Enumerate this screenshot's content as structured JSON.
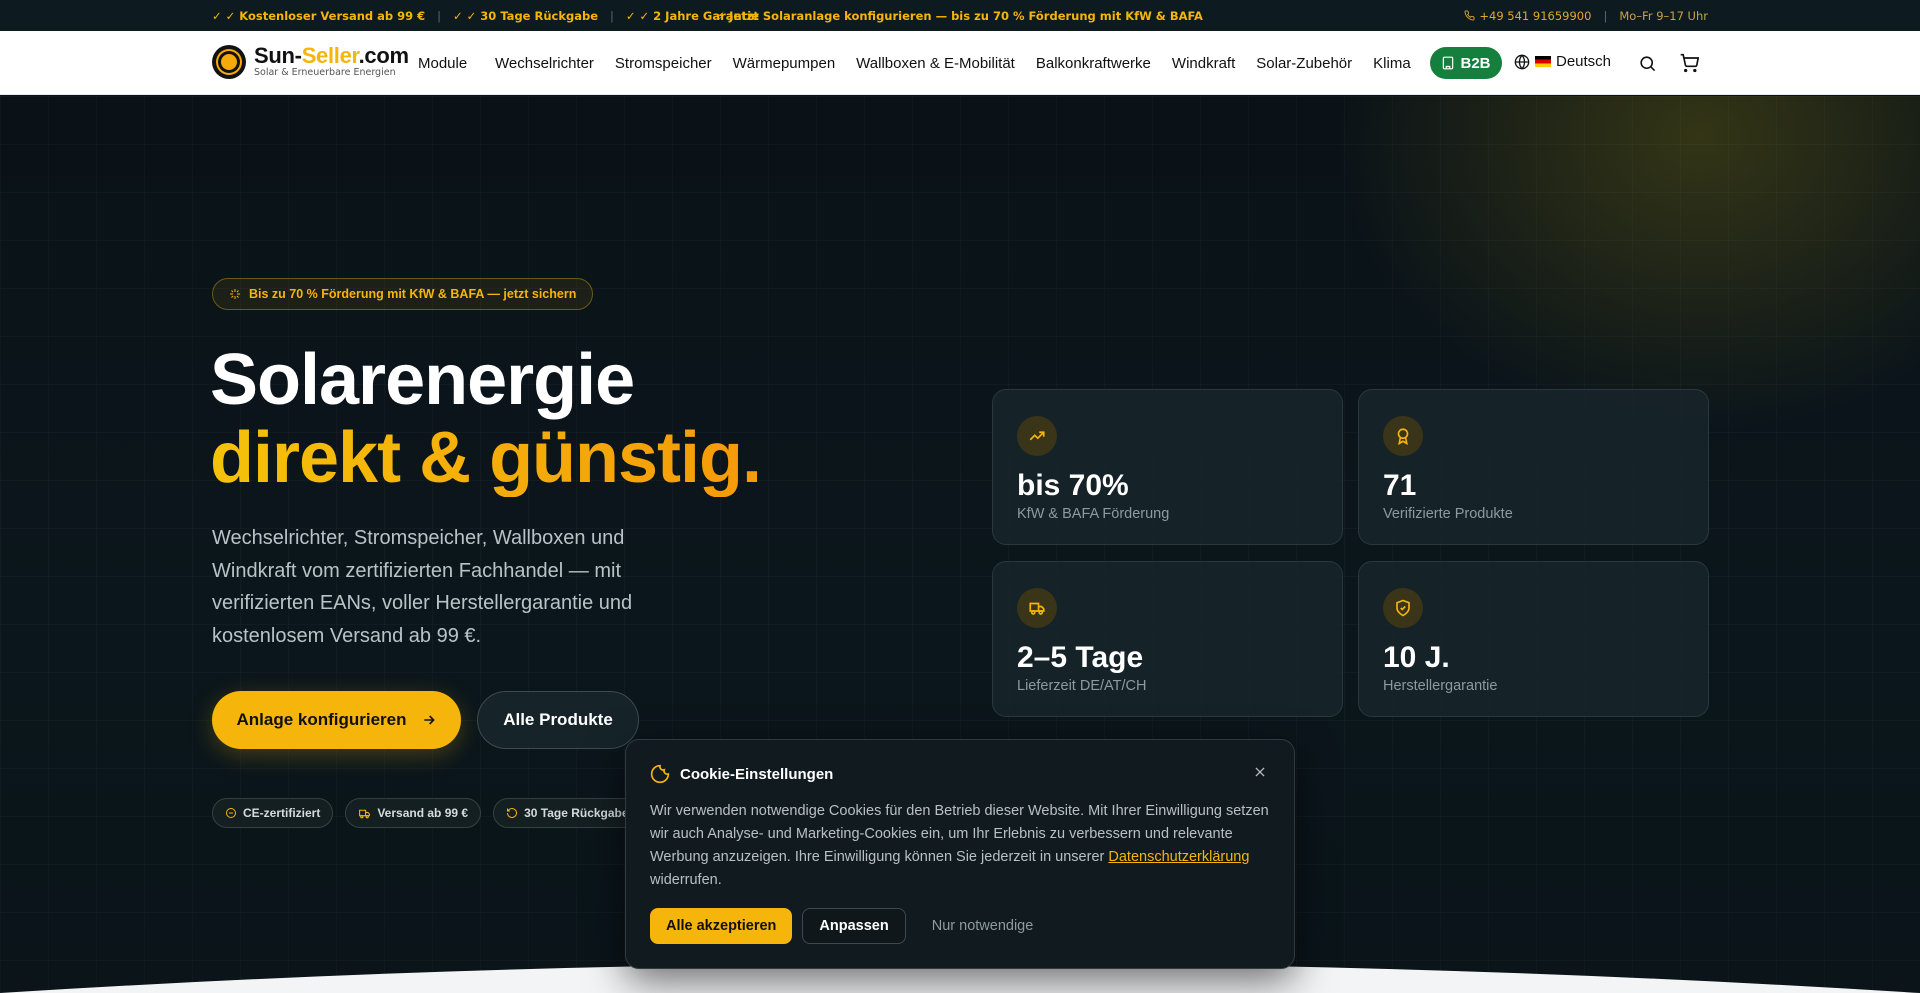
{
  "topbar": {
    "left": [
      "✓ ✓ Kostenloser Versand ab 99 €",
      "✓ ✓ 30 Tage Rückgabe",
      "✓ ✓ 2 Jahre Garantie"
    ],
    "separator": "|",
    "center": "⚡ Jetzt Solaranlage konfigurieren — bis zu 70 % Förderung mit KfW & BAFA",
    "phone": "+49 541 91659900",
    "hours": "Mo–Fr 9–17 Uhr"
  },
  "header": {
    "logo_name_part1": "Sun-",
    "logo_name_part2": "Seller",
    "logo_name_part3": ".com",
    "logo_tagline": "Solar & Erneuerbare Energien",
    "nav": [
      "Module",
      "Wechselrichter",
      "Stromspeicher",
      "Wärmepumpen",
      "Wallboxen & E-Mobilität",
      "Balkonkraftwerke",
      "Windkraft",
      "Solar-Zubehör",
      "Klima"
    ],
    "b2b": "B2B",
    "language": "Deutsch"
  },
  "hero": {
    "pill": "Bis zu 70 % Förderung mit KfW & BAFA — jetzt sichern",
    "title_line1": "Solarenergie",
    "title_line2": "direkt & günstig.",
    "lead": "Wechselrichter, Stromspeicher, Wallboxen und Windkraft vom zertifizierten Fachhandel — mit verifizierten EANs, voller Herstellergarantie und kostenlosem Versand ab 99 €.",
    "cta_primary": "Anlage konfigurieren",
    "cta_secondary": "Alle Produkte",
    "badges": [
      "CE-zertifiziert",
      "Versand ab 99 €",
      "30 Tage Rückgabe"
    ]
  },
  "stats": [
    {
      "value": "bis 70%",
      "label": "KfW & BAFA Förderung",
      "icon": "trending-up-icon"
    },
    {
      "value": "71",
      "label": "Verifizierte Produkte",
      "icon": "award-icon"
    },
    {
      "value": "2–5 Tage",
      "label": "Lieferzeit DE/AT/CH",
      "icon": "truck-icon"
    },
    {
      "value": "10 J.",
      "label": "Herstellergarantie",
      "icon": "shield-check-icon"
    }
  ],
  "cookie": {
    "title": "Cookie-Einstellungen",
    "text_before": "Wir verwenden notwendige Cookies für den Betrieb dieser Website. Mit Ihrer Einwilligung setzen wir auch Analyse- und Marketing-Cookies ein, um Ihr Erlebnis zu verbessern und relevante Werbung anzuzeigen. Ihre Einwilligung können Sie jederzeit in unserer ",
    "link": "Datenschutzerklärung",
    "text_after": " widerrufen.",
    "accept": "Alle akzeptieren",
    "customize": "Anpassen",
    "necessary": "Nur notwendige"
  },
  "colors": {
    "accent": "#f5b50a",
    "b2b_green": "#15803d",
    "background": "#0a1217"
  }
}
